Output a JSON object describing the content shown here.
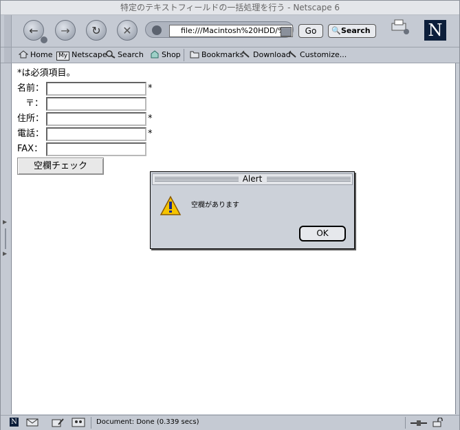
{
  "window": {
    "title": "特定のテキストフィールドの一括処理を行う - Netscape 6"
  },
  "toolbar": {
    "back_icon": "back-arrow-icon",
    "forward_icon": "forward-arrow-icon",
    "reload_icon": "reload-icon",
    "stop_icon": "stop-icon",
    "url_value": "file:///Macintosh%20HDD/%9",
    "go_label": "Go",
    "search_label": "Search"
  },
  "personal_bar": {
    "items": [
      {
        "label": "Home",
        "icon": "home-icon"
      },
      {
        "label": "Netscape",
        "icon": "my-netscape-icon",
        "badge": "My"
      },
      {
        "label": "Search",
        "icon": "search-icon"
      },
      {
        "label": "Shop",
        "icon": "shop-icon"
      },
      {
        "label": "Bookmarks",
        "icon": "folder-icon"
      },
      {
        "label": "Download",
        "icon": "bookmark-link-icon"
      },
      {
        "label": "Customize...",
        "icon": "bookmark-link-icon"
      }
    ]
  },
  "page": {
    "note": "*は必須項目。",
    "fields": [
      {
        "label": "名前：",
        "value": "",
        "required": "*"
      },
      {
        "label": "〒：",
        "value": "",
        "required": ""
      },
      {
        "label": "住所：",
        "value": "",
        "required": "*"
      },
      {
        "label": "電話：",
        "value": "",
        "required": "*"
      },
      {
        "label": "FAX：",
        "value": "",
        "required": ""
      }
    ],
    "check_button": "空欄チェック"
  },
  "alert": {
    "title": "Alert",
    "message": "空欄があります",
    "ok_label": "OK",
    "icon": "warning-icon"
  },
  "status": {
    "text": "Document: Done (0.339 secs)"
  },
  "colors": {
    "chrome": "#c5cad3",
    "logo": "#0c1e3a"
  }
}
